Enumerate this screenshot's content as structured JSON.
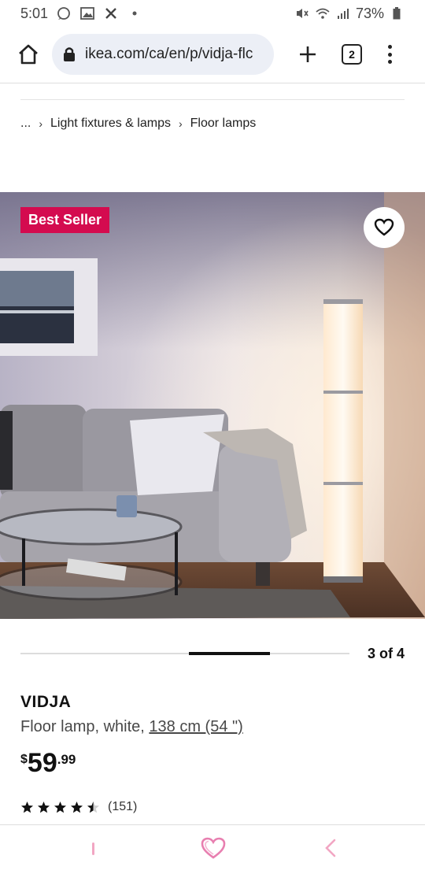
{
  "status_bar": {
    "time": "5:01",
    "battery": "73%",
    "icons": [
      "whatsapp-icon",
      "gallery-icon",
      "x-icon",
      "dot-icon",
      "mute-icon",
      "wifi-icon",
      "signal-icon",
      "battery-icon"
    ]
  },
  "browser": {
    "url": "ikea.com/ca/en/p/vidja-flc",
    "tab_count": "2",
    "icons": [
      "home-icon",
      "lock-icon",
      "plus-icon",
      "tabs-icon",
      "menu-icon"
    ]
  },
  "breadcrumb": {
    "items": [
      "...",
      "Light fixtures & lamps",
      "Floor lamps"
    ]
  },
  "product_image": {
    "badge": "Best Seller",
    "badge_color": "#d40b4f",
    "favorite_icon": "heart-outline-icon"
  },
  "carousel": {
    "position_label": "3 of 4",
    "current": 3,
    "total": 4
  },
  "product": {
    "name": "VIDJA",
    "description": "Floor lamp, white, ",
    "size": "138 cm (54 \")",
    "price_currency": "$",
    "price_int": "59",
    "price_dec": ".99",
    "rating_value": 4.5,
    "rating_count": "(151)"
  },
  "bottom_nav": {
    "icons": [
      "recent-icon",
      "heart-icon",
      "back-chevron-icon"
    ],
    "accent_color": "#f2a6c3"
  }
}
